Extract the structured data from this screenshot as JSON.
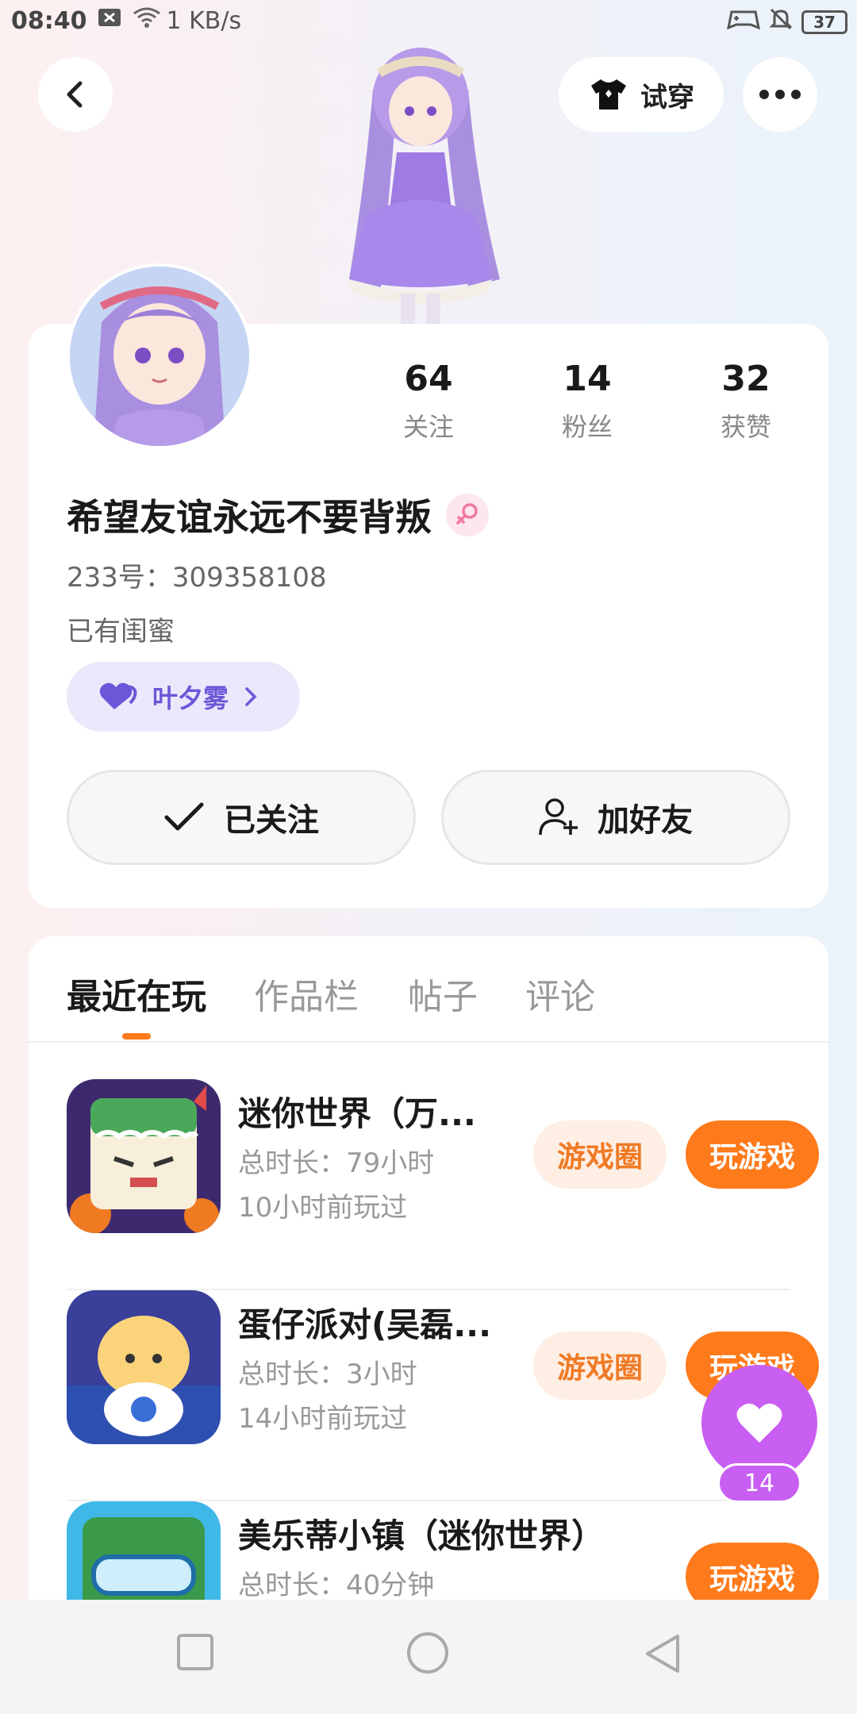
{
  "status_bar": {
    "time": "08:40",
    "net_speed": "1 KB/s",
    "battery": "37"
  },
  "header": {
    "tryon_label": "试穿"
  },
  "profile": {
    "stats": [
      {
        "num": "64",
        "label": "关注"
      },
      {
        "num": "14",
        "label": "粉丝"
      },
      {
        "num": "32",
        "label": "获赞"
      }
    ],
    "username": "希望友谊永远不要背叛",
    "uid": "233号：309358108",
    "bestie_status": "已有闺蜜",
    "bestie_name": "叶夕雾",
    "followed_label": "已关注",
    "add_friend_label": "加好友"
  },
  "tabs": [
    "最近在玩",
    "作品栏",
    "帖子",
    "评论"
  ],
  "games": [
    {
      "name": "迷你世界（万...",
      "total": "总时长：79小时",
      "last": "10小时前玩过",
      "circle_label": "游戏圈",
      "play_label": "玩游戏"
    },
    {
      "name": "蛋仔派对(吴磊...",
      "total": "总时长：3小时",
      "last": "14小时前玩过",
      "circle_label": "游戏圈",
      "play_label": "玩游戏"
    },
    {
      "name": "美乐蒂小镇（迷你世界）",
      "total": "总时长：40分钟",
      "last": "",
      "circle_label": "",
      "play_label": "玩游戏"
    }
  ],
  "like": {
    "count": "14"
  },
  "colors": {
    "accent": "#ff7a1a",
    "like": "#c85ef2",
    "bestie": "#6b57d8"
  }
}
